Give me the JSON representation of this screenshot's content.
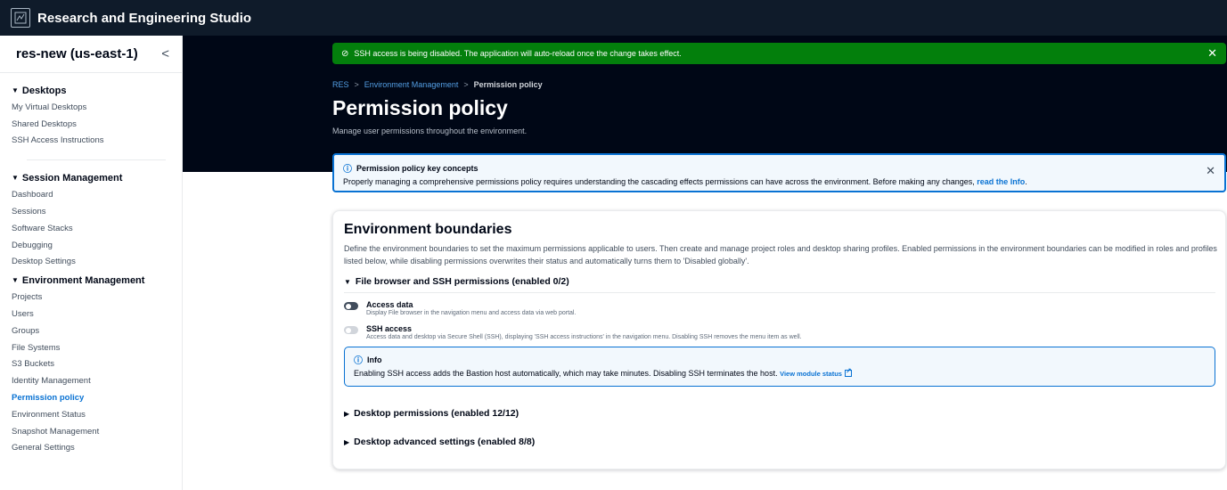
{
  "app": {
    "title": "Research and Engineering Studio"
  },
  "sidebar": {
    "title": "res-new (us-east-1)",
    "sections": [
      {
        "label": "Desktops",
        "items": [
          "My Virtual Desktops",
          "Shared Desktops",
          "SSH Access Instructions"
        ]
      },
      {
        "label": "Session Management",
        "items": [
          "Dashboard",
          "Sessions",
          "Software Stacks",
          "Debugging",
          "Desktop Settings"
        ]
      },
      {
        "label": "Environment Management",
        "items": [
          "Projects",
          "Users",
          "Groups",
          "File Systems",
          "S3 Buckets",
          "Identity Management",
          "Permission policy",
          "Environment Status",
          "Snapshot Management",
          "General Settings"
        ]
      }
    ],
    "active_item": "Permission policy"
  },
  "flash": {
    "message": "SSH access is being disabled. The application will auto-reload once the change takes effect."
  },
  "breadcrumbs": {
    "items": [
      "RES",
      "Environment Management"
    ],
    "current": "Permission policy"
  },
  "page": {
    "title": "Permission policy",
    "description": "Manage user permissions throughout the environment."
  },
  "info_banner": {
    "title": "Permission policy key concepts",
    "body": "Properly managing a comprehensive permissions policy requires understanding the cascading effects permissions can have across the environment. Before making any changes, ",
    "link": "read the Info",
    "suffix": "."
  },
  "card": {
    "title": "Environment boundaries",
    "description": "Define the environment boundaries to set the maximum permissions applicable to users. Then create and manage project roles and desktop sharing profiles. Enabled permissions in the environment boundaries can be modified in roles and profiles listed below, while disabling permissions overwrites their status and automatically turns them to 'Disabled globally'.",
    "sections": {
      "file_browser": {
        "label": "File browser and SSH permissions (enabled 0/2)",
        "permissions": [
          {
            "name": "Access data",
            "description": "Display File browser in the navigation menu and access data via web portal.",
            "enabled": false
          },
          {
            "name": "SSH access",
            "description": "Access data and desktop via Secure Shell (SSH), displaying 'SSH access instructions' in the navigation menu. Disabling SSH removes the menu item as well.",
            "enabled": false
          }
        ],
        "info": {
          "title": "Info",
          "body": "Enabling SSH access adds the Bastion host automatically, which may take minutes. Disabling SSH terminates the host. ",
          "link": "View module status"
        }
      },
      "desktop_permissions": {
        "label": "Desktop permissions (enabled 12/12)"
      },
      "desktop_advanced": {
        "label": "Desktop advanced settings (enabled 8/8)"
      }
    }
  },
  "colors": {
    "nav_bg": "#0f1b2a",
    "header_bg": "#000716",
    "success": "#037f0c",
    "accent": "#0972d3"
  }
}
